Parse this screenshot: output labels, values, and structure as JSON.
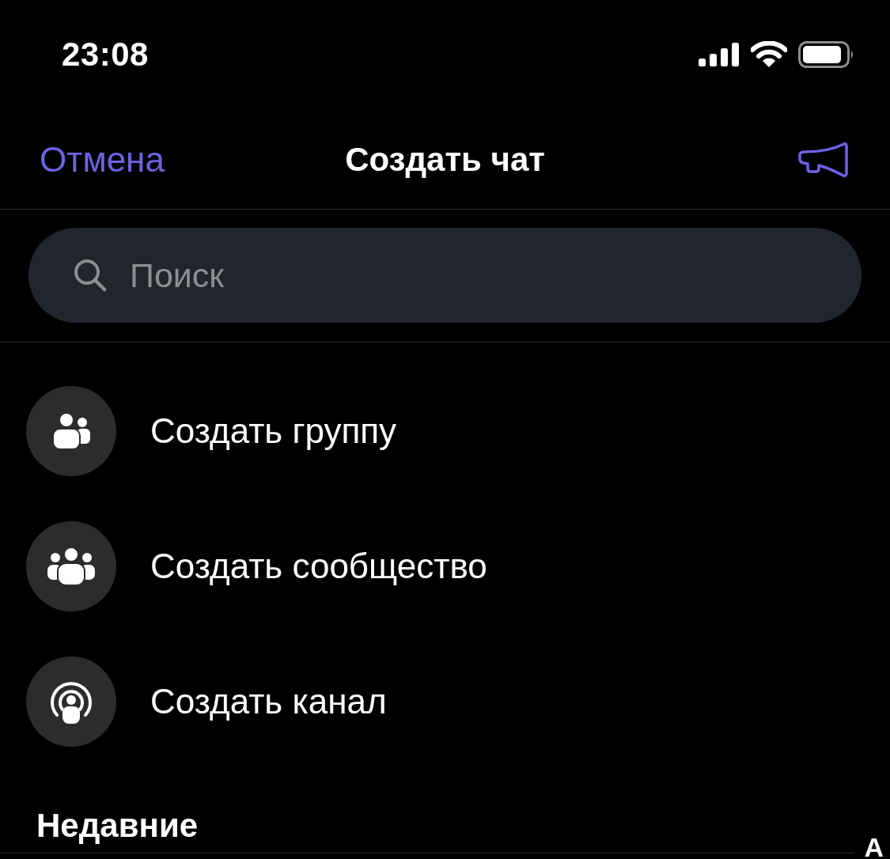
{
  "status_bar": {
    "time": "23:08"
  },
  "nav_bar": {
    "cancel": "Отмена",
    "title": "Создать чат"
  },
  "search": {
    "placeholder": "Поиск"
  },
  "actions": [
    {
      "kind": "group",
      "label": "Создать группу"
    },
    {
      "kind": "community",
      "label": "Создать сообщество"
    },
    {
      "kind": "channel",
      "label": "Создать канал"
    }
  ],
  "sections": [
    {
      "title": "Недавние"
    }
  ],
  "index_letters": [
    "А"
  ]
}
